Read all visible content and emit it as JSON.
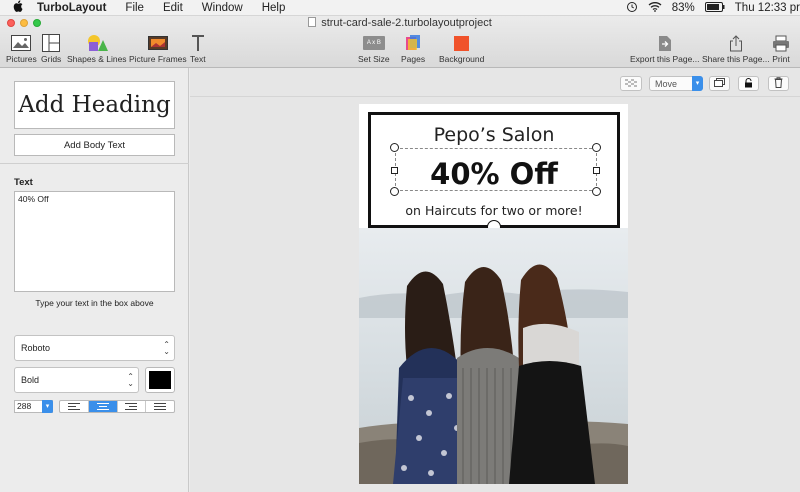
{
  "menubar": {
    "apple_icon": "apple-icon",
    "app_name": "TurboLayout",
    "menus": [
      "File",
      "Edit",
      "Window",
      "Help"
    ],
    "battery": "83%",
    "clock": "Thu 12:33 pr"
  },
  "window": {
    "document_title": "strut-card-sale-2.turbolayoutproject"
  },
  "toolbar": {
    "pictures": "Pictures",
    "grids": "Grids",
    "shapes": "Shapes & Lines",
    "frames": "Picture Frames",
    "text": "Text",
    "set_size": "Set Size",
    "pages": "Pages",
    "background": "Background",
    "export": "Export this Page...",
    "share": "Share this Page...",
    "print": "Print",
    "set_size_icon_text": "A x B",
    "background_color": "#f0522a"
  },
  "sidebar": {
    "add_heading": "Add Heading",
    "add_body": "Add Body Text",
    "text_label": "Text",
    "text_value": "40% Off",
    "hint": "Type your text in the box above",
    "font": "Roboto",
    "weight": "Bold",
    "text_color": "#000000",
    "font_size": "288"
  },
  "canvas": {
    "mode": "Move"
  },
  "card": {
    "salon": "Pepo’s Salon",
    "discount": "40% Off",
    "tagline": "on Haircuts for two or more!"
  }
}
